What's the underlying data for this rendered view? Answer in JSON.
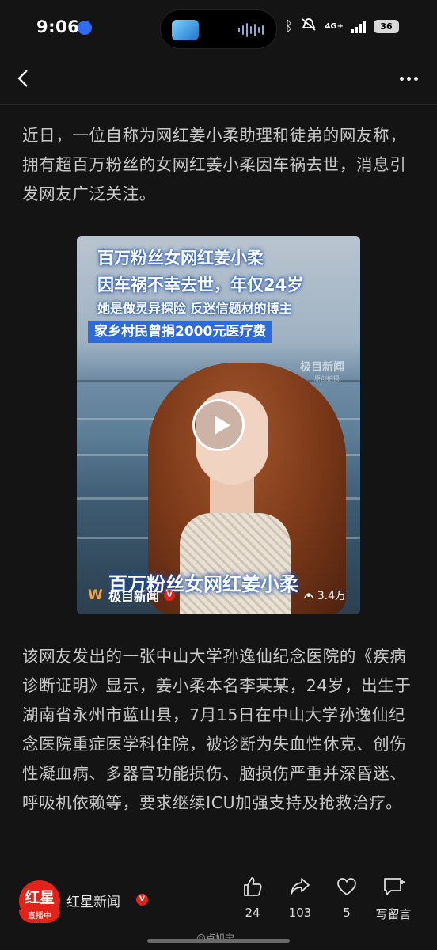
{
  "status_bar": {
    "time": "9:06",
    "network": "4G+",
    "battery": "36",
    "icons": [
      "location-app-icon",
      "bluetooth-icon",
      "mute-icon",
      "signal-icon",
      "battery-icon"
    ]
  },
  "nav": {
    "icons": [
      "back-arrow-icon",
      "more-dots-icon"
    ]
  },
  "article": {
    "paragraph_1": "近日，一位自称为网红姜小柔助理和徒弟的网友称，拥有超百万粉丝的女网红姜小柔因车祸去世，消息引发网友广泛关注。",
    "paragraph_2": "该网友发出的一张中山大学孙逸仙纪念医院的《疾病诊断证明》显示，姜小柔本名李某某，24岁，出生于湖南省永州市蓝山县，7月15日在中山大学孙逸仙纪念医院重症医学科住院，被诊断为失血性休克、创伤性凝血病、多器官功能损伤、脑损伤严重并深昏迷、呼吸机依赖等，要求继续ICU加强支持及抢救治疗。"
  },
  "video": {
    "headline_1": "百万粉丝女网红姜小柔",
    "headline_2": "因车祸不幸去世，年仅24岁",
    "headline_3": "她是做灵异探险 反迷信题材的博主",
    "headline_4": "家乡村民曾捐2000元医疗费",
    "watermark": "极目新闻",
    "watermark_sub": "原创拍摄",
    "caption": "百万粉丝女网红姜小柔",
    "source": "极目新闻",
    "views": "3.4万"
  },
  "bottom_bar": {
    "channel_logo": "红星",
    "live_label": "直播中",
    "channel_name": "红星新闻",
    "like_count": "24",
    "share_count": "103",
    "favorite_count": "5",
    "comment_label": "写留言"
  },
  "watermark": "@卢旭宁",
  "colors": {
    "background": "#141414",
    "accent_red": "#e2231a",
    "headline_blue": "#2f6bd8"
  }
}
